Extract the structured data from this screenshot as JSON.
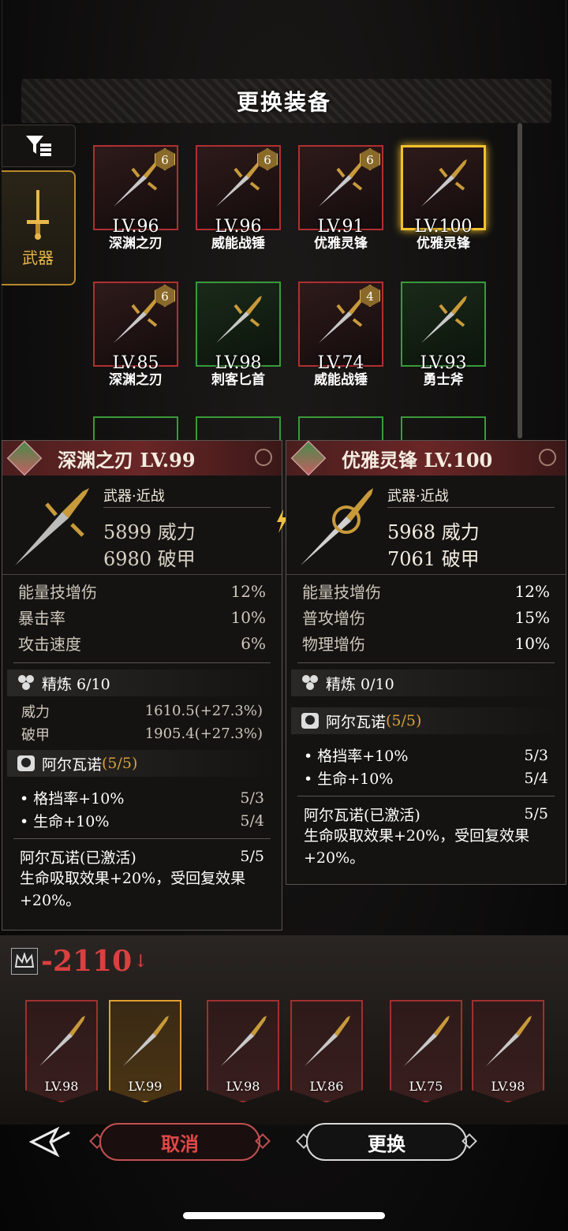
{
  "title": "更换装备",
  "sidebar": {
    "filter_icon": "filter-icon",
    "weapon_tab_label": "武器"
  },
  "inventory": [
    {
      "level": "LV.96",
      "name": "深渊之刃",
      "tier": "6",
      "rarity": "red"
    },
    {
      "level": "LV.96",
      "name": "威能战锤",
      "tier": "6",
      "rarity": "red"
    },
    {
      "level": "LV.91",
      "name": "优雅灵锋",
      "tier": "6",
      "rarity": "red"
    },
    {
      "level": "LV.100",
      "name": "优雅灵锋",
      "tier": "",
      "rarity": "gold-selected"
    },
    {
      "level": "LV.85",
      "name": "深渊之刃",
      "tier": "6",
      "rarity": "red"
    },
    {
      "level": "LV.98",
      "name": "刺客匕首",
      "tier": "",
      "rarity": "green"
    },
    {
      "level": "LV.74",
      "name": "威能战锤",
      "tier": "4",
      "rarity": "red"
    },
    {
      "level": "LV.93",
      "name": "勇士斧",
      "tier": "",
      "rarity": "green"
    }
  ],
  "current": {
    "title": "深渊之刃 LV.99",
    "type": "武器·近战",
    "power": "5899 威力",
    "armor_break": "6980 破甲",
    "stats": [
      {
        "label": "能量技增伤",
        "value": "12%"
      },
      {
        "label": "暴击率",
        "value": "10%"
      },
      {
        "label": "攻击速度",
        "value": "6%"
      }
    ],
    "refine": {
      "label": "精炼 6/10",
      "rows": [
        {
          "label": "威力",
          "value": "1610.5(+27.3%)"
        },
        {
          "label": "破甲",
          "value": "1905.4(+27.3%)"
        }
      ]
    },
    "set_name": "阿尔瓦诺",
    "set_count": "(5/5)",
    "set_bonuses": [
      {
        "label": "• 格挡率+10%",
        "value": "5/3"
      },
      {
        "label": "• 生命+10%",
        "value": "5/4"
      }
    ],
    "set_active_label": "阿尔瓦诺(已激活)",
    "set_active_value": "5/5",
    "set_desc": "生命吸取效果+20%，受回复效果+20%。"
  },
  "candidate": {
    "title": "优雅灵锋 LV.100",
    "type": "武器·近战",
    "power": "5968 威力",
    "armor_break": "7061 破甲",
    "stats": [
      {
        "label": "能量技增伤",
        "value": "12%"
      },
      {
        "label": "普攻增伤",
        "value": "15%"
      },
      {
        "label": "物理增伤",
        "value": "10%"
      }
    ],
    "refine": {
      "label": "精炼 0/10"
    },
    "set_name": "阿尔瓦诺",
    "set_count": "(5/5)",
    "set_bonuses": [
      {
        "label": "• 格挡率+10%",
        "value": "5/3"
      },
      {
        "label": "• 生命+10%",
        "value": "5/4"
      }
    ],
    "set_active_label": "阿尔瓦诺(已激活)",
    "set_active_value": "5/5",
    "set_desc": "生命吸取效果+20%，受回复效果+20%。"
  },
  "power_delta": "-2110",
  "equipped": [
    {
      "level": "LV.98",
      "current": false
    },
    {
      "level": "LV.99",
      "current": true
    },
    {
      "level": "LV.98",
      "current": false
    },
    {
      "level": "LV.86",
      "current": false
    },
    {
      "level": "LV.75",
      "current": false
    },
    {
      "level": "LV.98",
      "current": false
    }
  ],
  "buttons": {
    "cancel": "取消",
    "confirm": "更换"
  },
  "colors": {
    "red_rarity": "#b03030",
    "green_rarity": "#3a9a3a",
    "gold_selected": "#f2c12e",
    "delta": "#d94040",
    "accent": "#e8b84a"
  }
}
